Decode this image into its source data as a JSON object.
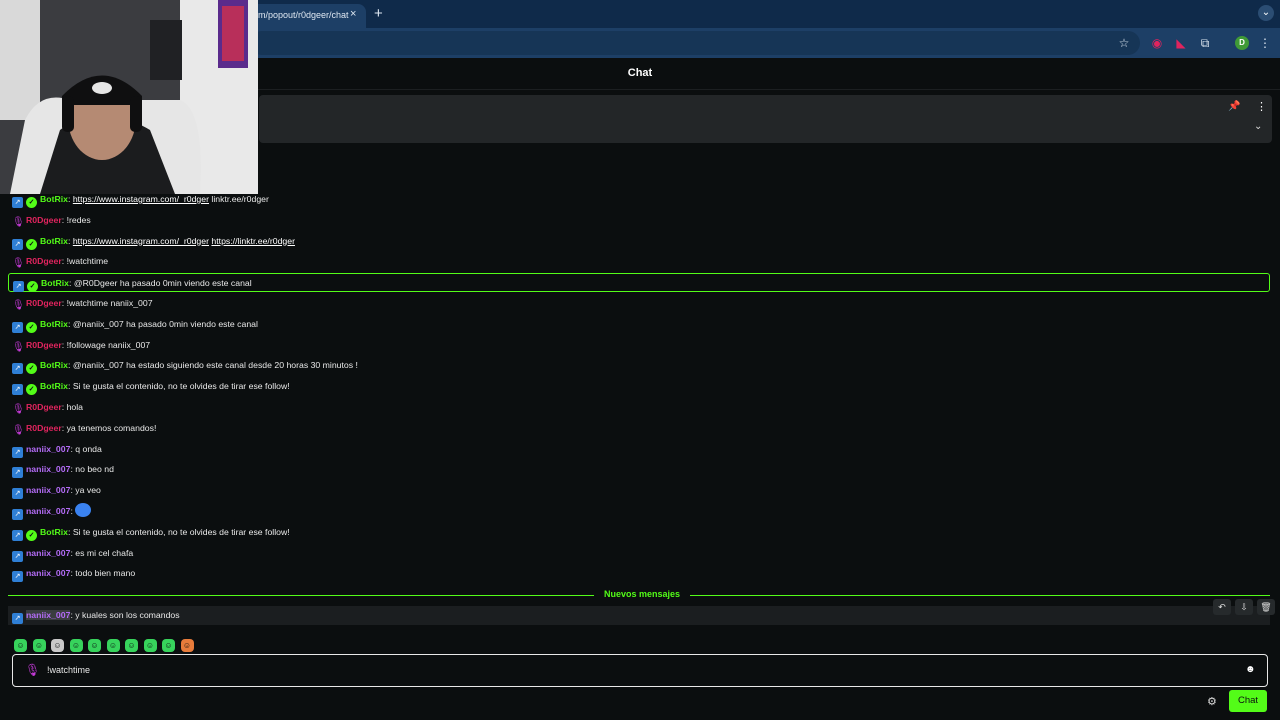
{
  "browser": {
    "tab_title": "m/popout/r0dgeer/chat",
    "tab_close": "×",
    "new_tab": "+",
    "profile_initial": "D",
    "tab_dropdown": "⌄"
  },
  "chat": {
    "title": "Chat",
    "new_messages_label": "Nuevos mensajes",
    "input_value": "!watchtime ",
    "send_label": "Chat"
  },
  "messages": [
    {
      "user": "BotRix",
      "kind": "bot",
      "text_parts": [
        {
          "t": "https://www.instagram.com/_r0dger",
          "link": true
        },
        {
          "t": " linktr.ee/r0dger",
          "link": false
        }
      ]
    },
    {
      "user": "R0Dgeer",
      "kind": "host",
      "text_parts": [
        {
          "t": "!redes",
          "link": false
        }
      ]
    },
    {
      "user": "BotRix",
      "kind": "bot",
      "text_parts": [
        {
          "t": "https://www.instagram.com/_r0dger",
          "link": true
        },
        {
          "t": " ",
          "link": false
        },
        {
          "t": "https://linktr.ee/r0dger",
          "link": true
        }
      ]
    },
    {
      "user": "R0Dgeer",
      "kind": "host",
      "text_parts": [
        {
          "t": "!watchtime",
          "link": false
        }
      ]
    },
    {
      "user": "BotRix",
      "kind": "bot",
      "highlight": true,
      "text_parts": [
        {
          "t": "@R0Dgeer ha pasado 0min viendo este canal",
          "link": false
        }
      ]
    },
    {
      "user": "R0Dgeer",
      "kind": "host",
      "text_parts": [
        {
          "t": "!watchtime naniix_007",
          "link": false
        }
      ]
    },
    {
      "user": "BotRix",
      "kind": "bot",
      "text_parts": [
        {
          "t": "@naniix_007 ha pasado 0min viendo este canal",
          "link": false
        }
      ]
    },
    {
      "user": "R0Dgeer",
      "kind": "host",
      "text_parts": [
        {
          "t": "!followage naniix_007",
          "link": false
        }
      ]
    },
    {
      "user": "BotRix",
      "kind": "bot",
      "text_parts": [
        {
          "t": "@naniix_007 ha estado siguiendo este canal desde 20 horas 30 minutos !",
          "link": false
        }
      ]
    },
    {
      "user": "BotRix",
      "kind": "bot",
      "text_parts": [
        {
          "t": "Si te gusta el contenido, no te olvides de tirar ese follow!",
          "link": false
        }
      ]
    },
    {
      "user": "R0Dgeer",
      "kind": "host",
      "text_parts": [
        {
          "t": "hola",
          "link": false
        }
      ]
    },
    {
      "user": "R0Dgeer",
      "kind": "host",
      "text_parts": [
        {
          "t": "ya tenemos comandos!",
          "link": false
        }
      ]
    },
    {
      "user": "naniix_007",
      "kind": "viewer",
      "text_parts": [
        {
          "t": "q onda",
          "link": false
        }
      ]
    },
    {
      "user": "naniix_007",
      "kind": "viewer",
      "text_parts": [
        {
          "t": "no beo nd",
          "link": false
        }
      ]
    },
    {
      "user": "naniix_007",
      "kind": "viewer",
      "text_parts": [
        {
          "t": "ya veo",
          "link": false
        }
      ]
    },
    {
      "user": "naniix_007",
      "kind": "viewer",
      "emote": true,
      "text_parts": []
    },
    {
      "user": "BotRix",
      "kind": "bot",
      "text_parts": [
        {
          "t": "Si te gusta el contenido, no te olvides de tirar ese follow!",
          "link": false
        }
      ]
    },
    {
      "user": "naniix_007",
      "kind": "viewer",
      "text_parts": [
        {
          "t": "es mi cel chafa",
          "link": false
        }
      ]
    },
    {
      "user": "naniix_007",
      "kind": "viewer",
      "text_parts": [
        {
          "t": "todo bien mano",
          "link": false
        }
      ]
    }
  ],
  "last_message": {
    "user": "naniix_007",
    "text": "y kuales son los comandos"
  },
  "icons": {
    "verified": "verified-badge-icon",
    "kick": "kick-badge-icon",
    "mic": "broadcaster-mic-icon"
  },
  "colors": {
    "accent": "#53fc18",
    "host": "#e0245e",
    "viewer": "#b36cf6",
    "tab_bar": "#0f2a4a"
  }
}
